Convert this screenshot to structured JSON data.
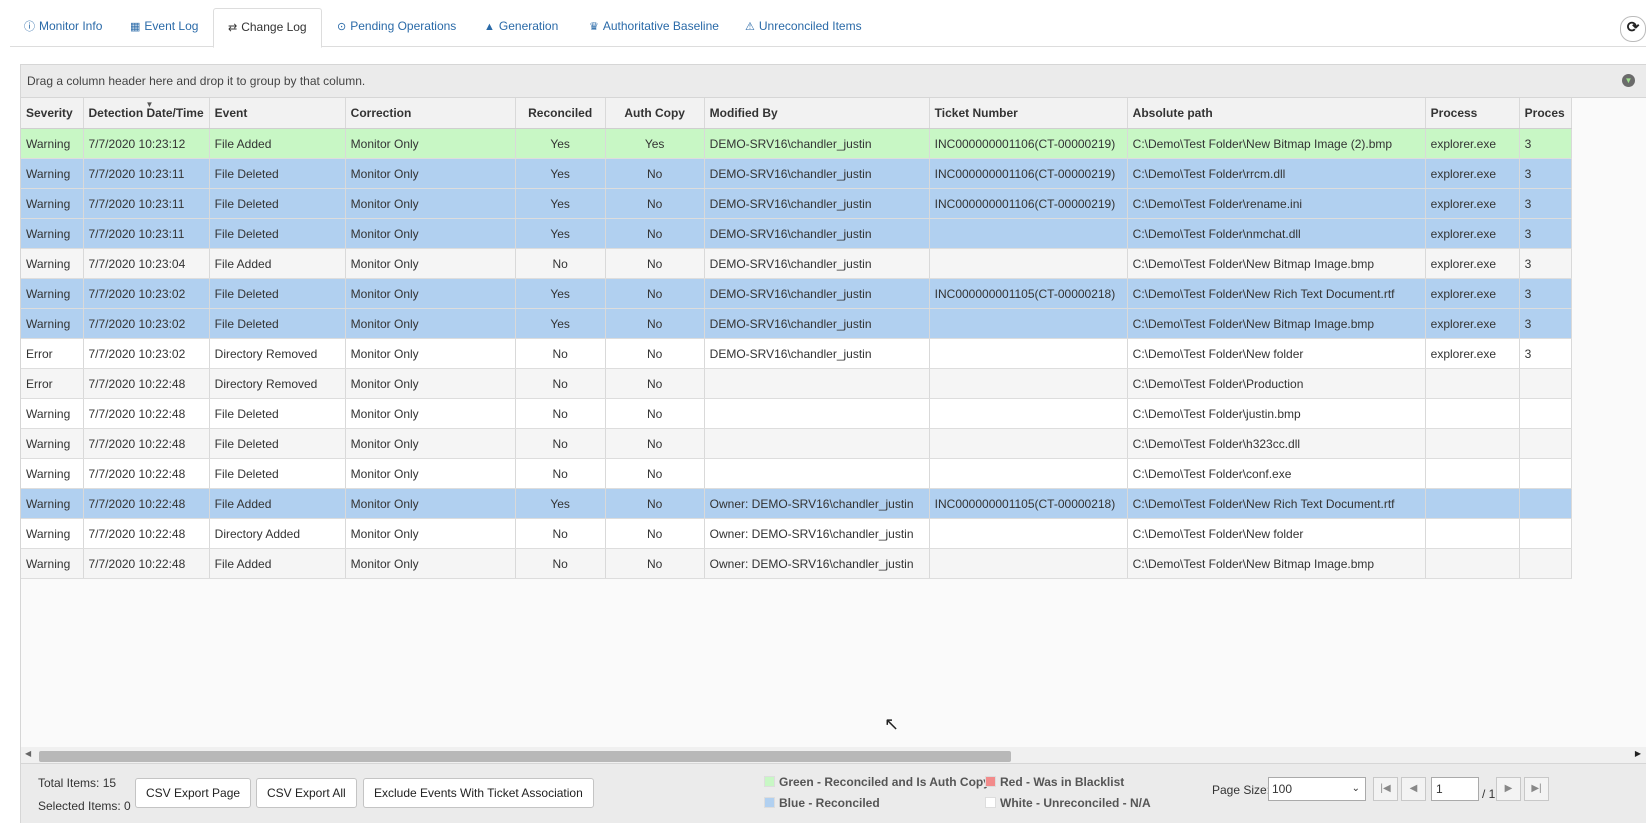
{
  "tabs": [
    {
      "icon": "ⓘ",
      "label": "Monitor Info"
    },
    {
      "icon": "▦",
      "label": "Event Log"
    },
    {
      "icon": "⇄",
      "label": "Change Log"
    },
    {
      "icon": "⊙",
      "label": "Pending Operations"
    },
    {
      "icon": "▲",
      "label": "Generation"
    },
    {
      "icon": "♛",
      "label": "Authoritative Baseline"
    },
    {
      "icon": "⚠",
      "label": "Unreconciled Items"
    }
  ],
  "active_tab": "Change Log",
  "group_hint": "Drag a column header here and drop it to group by that column.",
  "columns": [
    "Severity",
    "Detection Date/Time",
    "Event",
    "Correction",
    "Reconciled",
    "Auth Copy",
    "Modified By",
    "Ticket Number",
    "Absolute path",
    "Process",
    "Proces"
  ],
  "rows": [
    {
      "style": "green",
      "cells": [
        "Warning",
        "7/7/2020 10:23:12",
        "File Added",
        "Monitor Only",
        "Yes",
        "Yes",
        "DEMO-SRV16\\chandler_justin",
        "INC000000001106(CT-00000219)",
        "C:\\Demo\\Test Folder\\New Bitmap Image (2).bmp",
        "explorer.exe",
        "3"
      ]
    },
    {
      "style": "blue",
      "cells": [
        "Warning",
        "7/7/2020 10:23:11",
        "File Deleted",
        "Monitor Only",
        "Yes",
        "No",
        "DEMO-SRV16\\chandler_justin",
        "INC000000001106(CT-00000219)",
        "C:\\Demo\\Test Folder\\rrcm.dll",
        "explorer.exe",
        "3"
      ]
    },
    {
      "style": "blue",
      "cells": [
        "Warning",
        "7/7/2020 10:23:11",
        "File Deleted",
        "Monitor Only",
        "Yes",
        "No",
        "DEMO-SRV16\\chandler_justin",
        "INC000000001106(CT-00000219)",
        "C:\\Demo\\Test Folder\\rename.ini",
        "explorer.exe",
        "3"
      ]
    },
    {
      "style": "blue",
      "cells": [
        "Warning",
        "7/7/2020 10:23:11",
        "File Deleted",
        "Monitor Only",
        "Yes",
        "No",
        "DEMO-SRV16\\chandler_justin",
        "",
        "C:\\Demo\\Test Folder\\nmchat.dll",
        "explorer.exe",
        "3"
      ]
    },
    {
      "style": "alt",
      "cells": [
        "Warning",
        "7/7/2020 10:23:04",
        "File Added",
        "Monitor Only",
        "No",
        "No",
        "DEMO-SRV16\\chandler_justin",
        "",
        "C:\\Demo\\Test Folder\\New Bitmap Image.bmp",
        "explorer.exe",
        "3"
      ]
    },
    {
      "style": "blue",
      "cells": [
        "Warning",
        "7/7/2020 10:23:02",
        "File Deleted",
        "Monitor Only",
        "Yes",
        "No",
        "DEMO-SRV16\\chandler_justin",
        "INC000000001105(CT-00000218)",
        "C:\\Demo\\Test Folder\\New Rich Text Document.rtf",
        "explorer.exe",
        "3"
      ]
    },
    {
      "style": "blue",
      "cells": [
        "Warning",
        "7/7/2020 10:23:02",
        "File Deleted",
        "Monitor Only",
        "Yes",
        "No",
        "DEMO-SRV16\\chandler_justin",
        "",
        "C:\\Demo\\Test Folder\\New Bitmap Image.bmp",
        "explorer.exe",
        "3"
      ]
    },
    {
      "style": "white",
      "cells": [
        "Error",
        "7/7/2020 10:23:02",
        "Directory Removed",
        "Monitor Only",
        "No",
        "No",
        "DEMO-SRV16\\chandler_justin",
        "",
        "C:\\Demo\\Test Folder\\New folder",
        "explorer.exe",
        "3"
      ]
    },
    {
      "style": "alt",
      "cells": [
        "Error",
        "7/7/2020 10:22:48",
        "Directory Removed",
        "Monitor Only",
        "No",
        "No",
        "",
        "",
        "C:\\Demo\\Test Folder\\Production",
        "",
        ""
      ]
    },
    {
      "style": "white",
      "cells": [
        "Warning",
        "7/7/2020 10:22:48",
        "File Deleted",
        "Monitor Only",
        "No",
        "No",
        "",
        "",
        "C:\\Demo\\Test Folder\\justin.bmp",
        "",
        ""
      ]
    },
    {
      "style": "alt",
      "cells": [
        "Warning",
        "7/7/2020 10:22:48",
        "File Deleted",
        "Monitor Only",
        "No",
        "No",
        "",
        "",
        "C:\\Demo\\Test Folder\\h323cc.dll",
        "",
        ""
      ]
    },
    {
      "style": "white",
      "cells": [
        "Warning",
        "7/7/2020 10:22:48",
        "File Deleted",
        "Monitor Only",
        "No",
        "No",
        "",
        "",
        "C:\\Demo\\Test Folder\\conf.exe",
        "",
        ""
      ]
    },
    {
      "style": "blue",
      "cells": [
        "Warning",
        "7/7/2020 10:22:48",
        "File Added",
        "Monitor Only",
        "Yes",
        "No",
        "Owner: DEMO-SRV16\\chandler_justin",
        "INC000000001105(CT-00000218)",
        "C:\\Demo\\Test Folder\\New Rich Text Document.rtf",
        "",
        ""
      ]
    },
    {
      "style": "white",
      "cells": [
        "Warning",
        "7/7/2020 10:22:48",
        "Directory Added",
        "Monitor Only",
        "No",
        "No",
        "Owner: DEMO-SRV16\\chandler_justin",
        "",
        "C:\\Demo\\Test Folder\\New folder",
        "",
        ""
      ]
    },
    {
      "style": "alt",
      "cells": [
        "Warning",
        "7/7/2020 10:22:48",
        "File Added",
        "Monitor Only",
        "No",
        "No",
        "Owner: DEMO-SRV16\\chandler_justin",
        "",
        "C:\\Demo\\Test Folder\\New Bitmap Image.bmp",
        "",
        ""
      ]
    }
  ],
  "footer": {
    "total_items": "Total Items: 15",
    "selected_items": "Selected Items: 0",
    "btn_csv_page": "CSV Export Page",
    "btn_csv_all": "CSV Export All",
    "btn_exclude": "Exclude Events With Ticket Association",
    "legend": [
      {
        "label": "Green - Reconciled and Is Auth Copy",
        "color": "#c8f7c5"
      },
      {
        "label": "Red - Was in Blacklist",
        "color": "#f28b8b"
      },
      {
        "label": "Blue - Reconciled",
        "color": "#b1d0f0"
      },
      {
        "label": "White - Unreconciled - N/A",
        "color": "#ffffff"
      }
    ],
    "page_size_label": "Page Size:",
    "page_size_value": "100",
    "page_value": "1",
    "page_total": "/ 1"
  }
}
